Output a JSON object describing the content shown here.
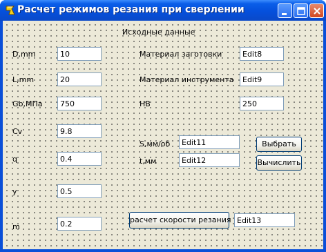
{
  "window": {
    "title": "Расчет режимов резания при сверлении",
    "icon": "delphi-app-icon",
    "colors": {
      "titlebar": "#0550dc",
      "client": "#ece9d8",
      "close_button": "#d2471f"
    }
  },
  "form": {
    "header": "Исходные данные",
    "params": [
      {
        "label": "D,mm",
        "value": "10"
      },
      {
        "label": "L,mm",
        "value": "20"
      },
      {
        "label": "Gb,МПа",
        "value": "750"
      },
      {
        "label": "Cv",
        "value": "9.8"
      },
      {
        "label": "q",
        "value": "0.4"
      },
      {
        "label": "y",
        "value": "0.5"
      },
      {
        "label": "m",
        "value": "0.2"
      }
    ],
    "material_workpiece": {
      "label": "Материал заготовки",
      "value": "Edit8"
    },
    "material_tool": {
      "label": "Материал инструмента",
      "value": "Edit9"
    },
    "hb": {
      "label": "HB",
      "value": "250"
    },
    "feed": {
      "label": "S,мм/об",
      "value": "Edit11"
    },
    "time": {
      "label": "t,мм",
      "value": "Edit12"
    },
    "buttons": {
      "select": "Выбрать",
      "calculate": "Вычислить",
      "speed": "расчет скорости резания"
    },
    "speed_result": "Edit13"
  }
}
